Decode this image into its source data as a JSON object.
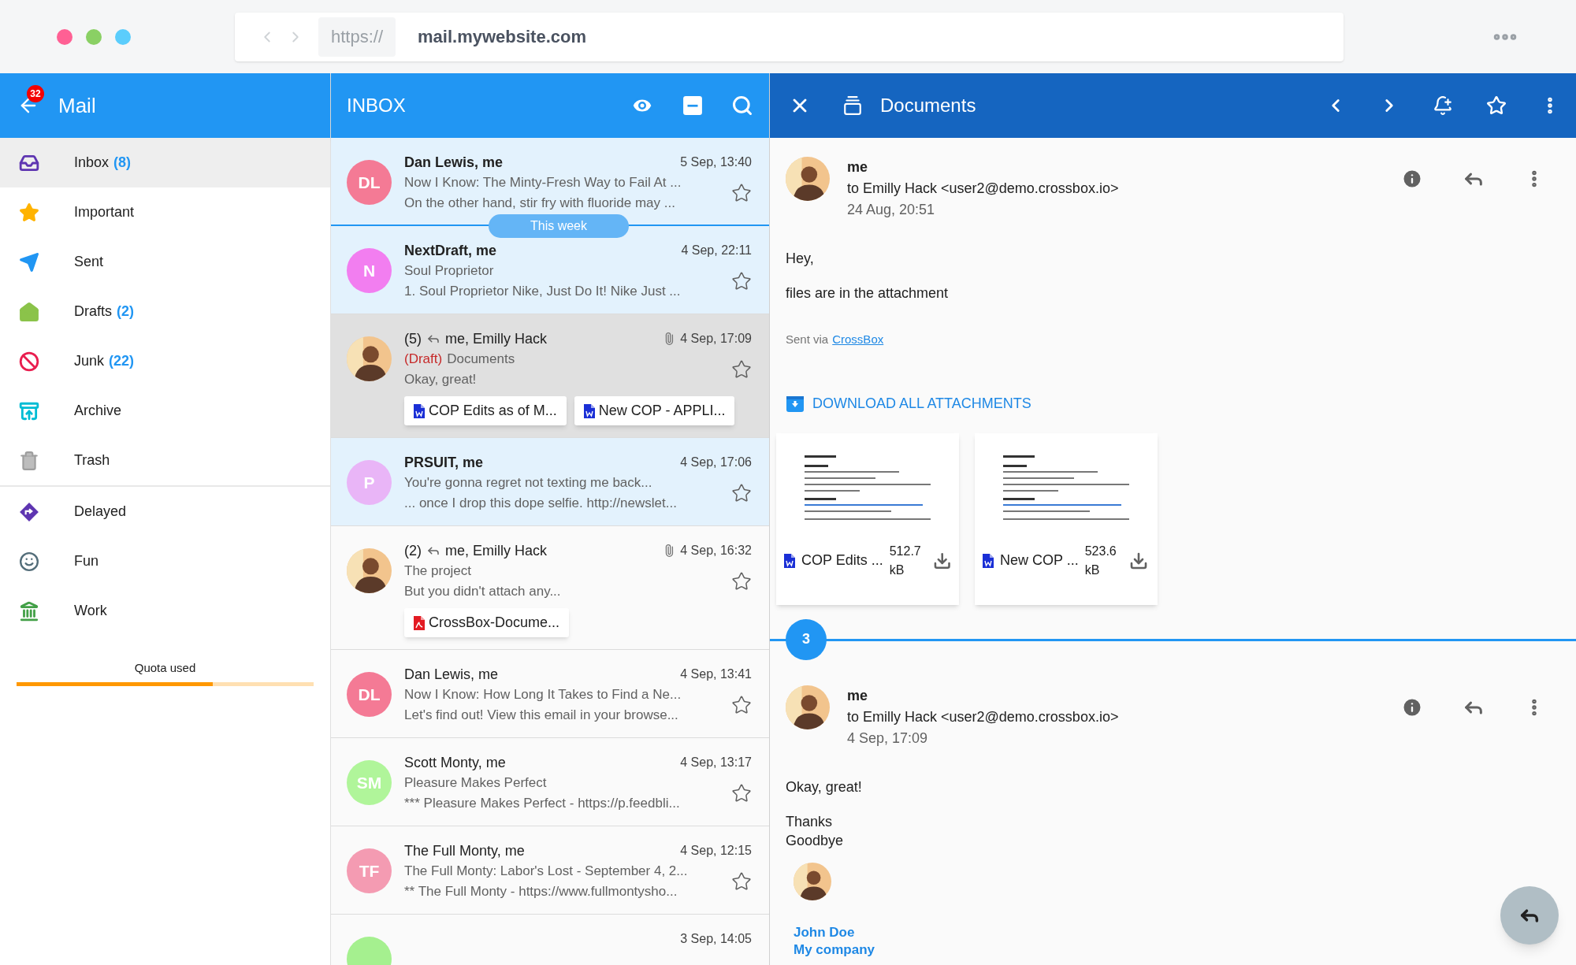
{
  "browser": {
    "scheme": "https://",
    "url": "mail.mywebsite.com"
  },
  "sidebar": {
    "title": "Mail",
    "badge": "32",
    "folders": [
      {
        "label": "Inbox",
        "count": "(8)",
        "selected": true
      },
      {
        "label": "Important",
        "selected": false
      },
      {
        "label": "Sent",
        "selected": false
      },
      {
        "label": "Drafts",
        "count": "(2)",
        "selected": false
      },
      {
        "label": "Junk",
        "count": "(22)",
        "selected": false
      },
      {
        "label": "Archive",
        "selected": false
      },
      {
        "label": "Trash",
        "selected": false
      }
    ],
    "labels": [
      {
        "label": "Delayed",
        "selected": false
      },
      {
        "label": "Fun",
        "selected": false
      },
      {
        "label": "Work",
        "selected": false
      }
    ],
    "quota": {
      "label": "Quota used",
      "level": 0.66
    }
  },
  "list": {
    "title": "INBOX",
    "messages": [
      {
        "kind": "message",
        "avatar": {
          "kind": "initials",
          "text": "DL",
          "color": "#f47a95"
        },
        "sender": "Dan Lewis, me",
        "date": "5 Sep, 13:40",
        "subject": "Now I Know: The Minty-Fresh Way to Fail At ...",
        "preview": "On the other hand, stir fry with fluoride may ...",
        "unread": true,
        "selected": false
      },
      {
        "kind": "divider",
        "label": "This week"
      },
      {
        "kind": "message",
        "avatar": {
          "kind": "initials",
          "text": "N",
          "color": "#f27ef0"
        },
        "sender": "NextDraft, me",
        "date": "4 Sep, 22:11",
        "subject": "Soul Proprietor",
        "preview": "1. Soul Proprietor Nike, Just Do It! Nike Just ...",
        "unread": true,
        "selected": false
      },
      {
        "kind": "message",
        "avatar": {
          "kind": "photo"
        },
        "count": "(5)",
        "replied": true,
        "sender": "me, Emilly Hack",
        "date": "4 Sep, 17:09",
        "draft_tag": "(Draft)",
        "subject": "Documents",
        "preview": "Okay, great!",
        "unread": false,
        "selected": true,
        "attachment": true,
        "files": [
          {
            "kind": "word",
            "name": "COP Edits as of M..."
          },
          {
            "kind": "word",
            "name": "New COP - APPLI..."
          }
        ]
      },
      {
        "kind": "message",
        "avatar": {
          "kind": "initials",
          "text": "P",
          "color": "#e9b5f7"
        },
        "sender": "PRSUIT, me",
        "date": "4 Sep, 17:06",
        "subject": "You're gonna regret not texting me back...",
        "preview": "... once I drop this dope selfie. http://newslet...",
        "unread": true,
        "selected": false
      },
      {
        "kind": "message",
        "avatar": {
          "kind": "photo"
        },
        "count": "(2)",
        "replied": true,
        "sender": "me, Emilly Hack",
        "date": "4 Sep, 16:32",
        "subject": "The project",
        "preview": "But you didn't attach any...",
        "unread": false,
        "selected": false,
        "attachment": true,
        "files": [
          {
            "kind": "pdf",
            "name": "CrossBox-Docume..."
          }
        ]
      },
      {
        "kind": "message",
        "avatar": {
          "kind": "initials",
          "text": "DL",
          "color": "#f47a95"
        },
        "sender": "Dan Lewis, me",
        "date": "4 Sep, 13:41",
        "subject": "Now I Know: How Long It Takes to Find a Ne...",
        "preview": "Let's find out!  View this email in your browse...",
        "unread": false,
        "selected": false
      },
      {
        "kind": "message",
        "avatar": {
          "kind": "initials",
          "text": "SM",
          "color": "#b0f59a"
        },
        "sender": "Scott Monty, me",
        "date": "4 Sep, 13:17",
        "subject": "Pleasure Makes Perfect",
        "preview": "*** Pleasure Makes Perfect - https://p.feedbli...",
        "unread": false,
        "selected": false
      },
      {
        "kind": "message",
        "avatar": {
          "kind": "initials",
          "text": "TF",
          "color": "#f49bb2"
        },
        "sender": "The Full Monty, me",
        "date": "4 Sep, 12:15",
        "subject": "The Full Monty: Labor's Lost - September 4, 2...",
        "preview": "** The Full Monty - https://www.fullmontysho...",
        "unread": false,
        "selected": false
      },
      {
        "kind": "message",
        "avatar": {
          "kind": "blank",
          "color": "#a5f08f"
        },
        "date": "3 Sep, 14:05",
        "unread": false,
        "selected": false
      }
    ]
  },
  "reader": {
    "title": "Documents",
    "thread": [
      {
        "kind": "message",
        "sender": "me",
        "to": "to Emilly Hack <user2@demo.crossbox.io>",
        "date": "24 Aug, 20:51",
        "body": [
          [
            "Hey,"
          ],
          [
            "files are in the attachment"
          ]
        ],
        "signature": {
          "kind": "sent_via",
          "text": "Sent via",
          "link": "CrossBox"
        },
        "download_all": "DOWNLOAD ALL ATTACHMENTS",
        "attachments": [
          {
            "kind": "word",
            "name": "COP Edits ...",
            "size": "512.7 kB"
          },
          {
            "kind": "word",
            "name": "New COP ...",
            "size": "523.6 kB"
          }
        ]
      },
      {
        "kind": "collapsed",
        "count": "3"
      },
      {
        "kind": "message",
        "sender": "me",
        "to": "to Emilly Hack <user2@demo.crossbox.io>",
        "date": "4 Sep, 17:09",
        "body": [
          [
            "Okay, great!"
          ],
          [
            "Thanks",
            "Goodbye"
          ]
        ],
        "signature": {
          "kind": "contact",
          "name": "John Doe",
          "company": "My company"
        }
      }
    ]
  }
}
